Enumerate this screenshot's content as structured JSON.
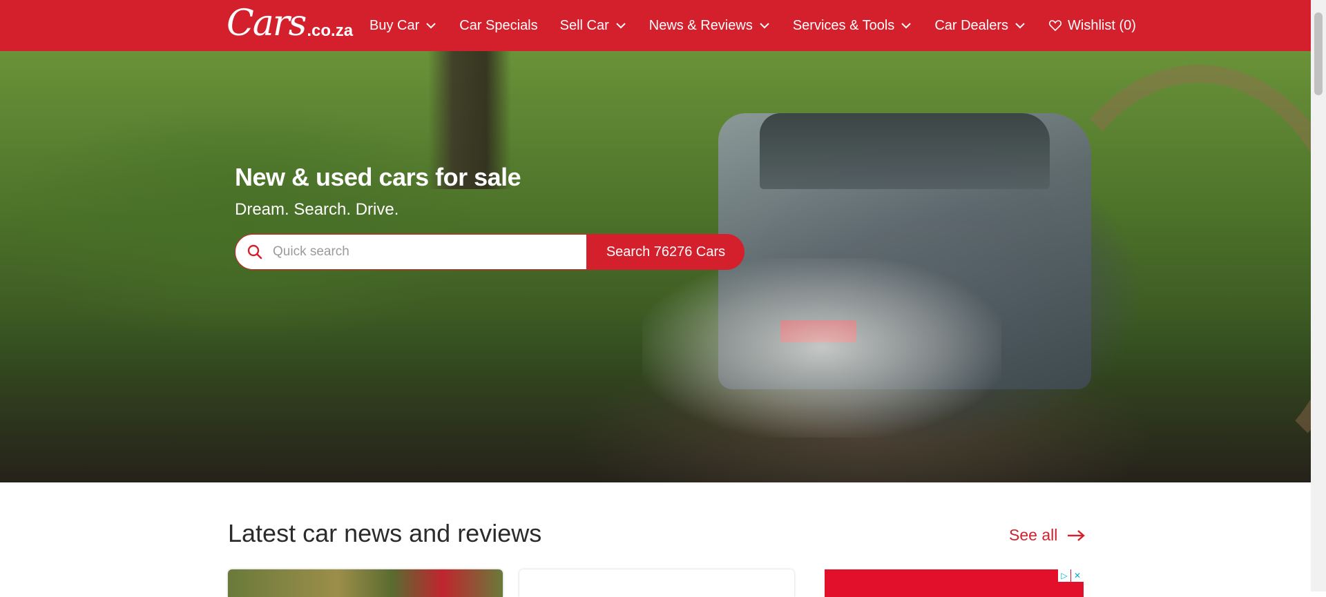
{
  "brand": {
    "logo_main": "Cars",
    "logo_tld": ".co.za"
  },
  "nav": {
    "items": [
      {
        "label": "Buy Car",
        "has_dropdown": true
      },
      {
        "label": "Car Specials",
        "has_dropdown": false
      },
      {
        "label": "Sell Car",
        "has_dropdown": true
      },
      {
        "label": "News & Reviews",
        "has_dropdown": true
      },
      {
        "label": "Services & Tools",
        "has_dropdown": true
      },
      {
        "label": "Car Dealers",
        "has_dropdown": true
      }
    ],
    "wishlist_label": "Wishlist (0)"
  },
  "hero": {
    "title": "New & used cars for sale",
    "subtitle": "Dream. Search. Drive.",
    "search_placeholder": "Quick search",
    "search_button": "Search 76276 Cars"
  },
  "news": {
    "title": "Latest car news and reviews",
    "see_all": "See all"
  },
  "colors": {
    "brand_red": "#d4202c",
    "text_dark": "#2b2b2b",
    "ad_red": "#e3102c"
  },
  "icons": [
    "chevron-down-icon",
    "heart-icon",
    "search-icon",
    "arrow-right-icon",
    "adchoices-icon",
    "close-icon"
  ]
}
